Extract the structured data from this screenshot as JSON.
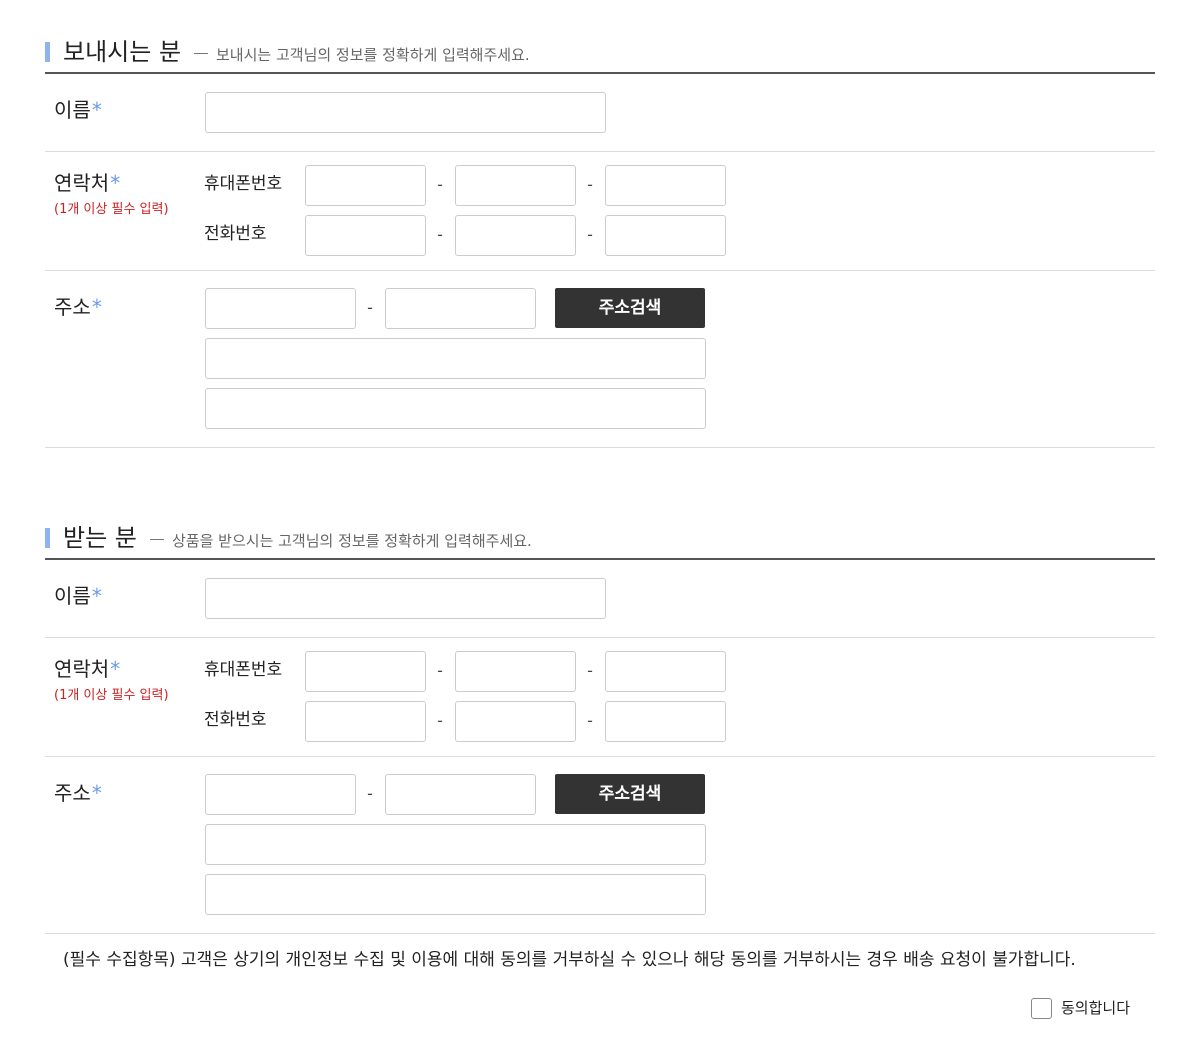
{
  "sender": {
    "title": "보내시는 분",
    "description": "보내시는 고객님의 정보를 정확하게 입력해주세요.",
    "name_label": "이름",
    "contact_label": "연락처",
    "contact_note": "(1개 이상 필수 입력)",
    "mobile_label": "휴대폰번호",
    "phone_label": "전화번호",
    "address_label": "주소",
    "address_search_button": "주소검색",
    "required_mark": "*",
    "hyphen": "-"
  },
  "receiver": {
    "title": "받는 분",
    "description": "상품을 받으시는 고객님의 정보를 정확하게 입력해주세요.",
    "name_label": "이름",
    "contact_label": "연락처",
    "contact_note": "(1개 이상 필수 입력)",
    "mobile_label": "휴대폰번호",
    "phone_label": "전화번호",
    "address_label": "주소",
    "address_search_button": "주소검색",
    "required_mark": "*",
    "hyphen": "-"
  },
  "consent": {
    "notice": "(필수 수집항목) 고객은 상기의 개인정보 수집 및 이용에 대해 동의를 거부하실 수 있으나 해당 동의를 거부하시는 경우 배송 요청이 불가합니다.",
    "agree_label": "동의합니다"
  },
  "colors": {
    "accent": "#8fb3f0",
    "required": "#6a9be6",
    "note": "#cc2222",
    "button": "#333333"
  }
}
